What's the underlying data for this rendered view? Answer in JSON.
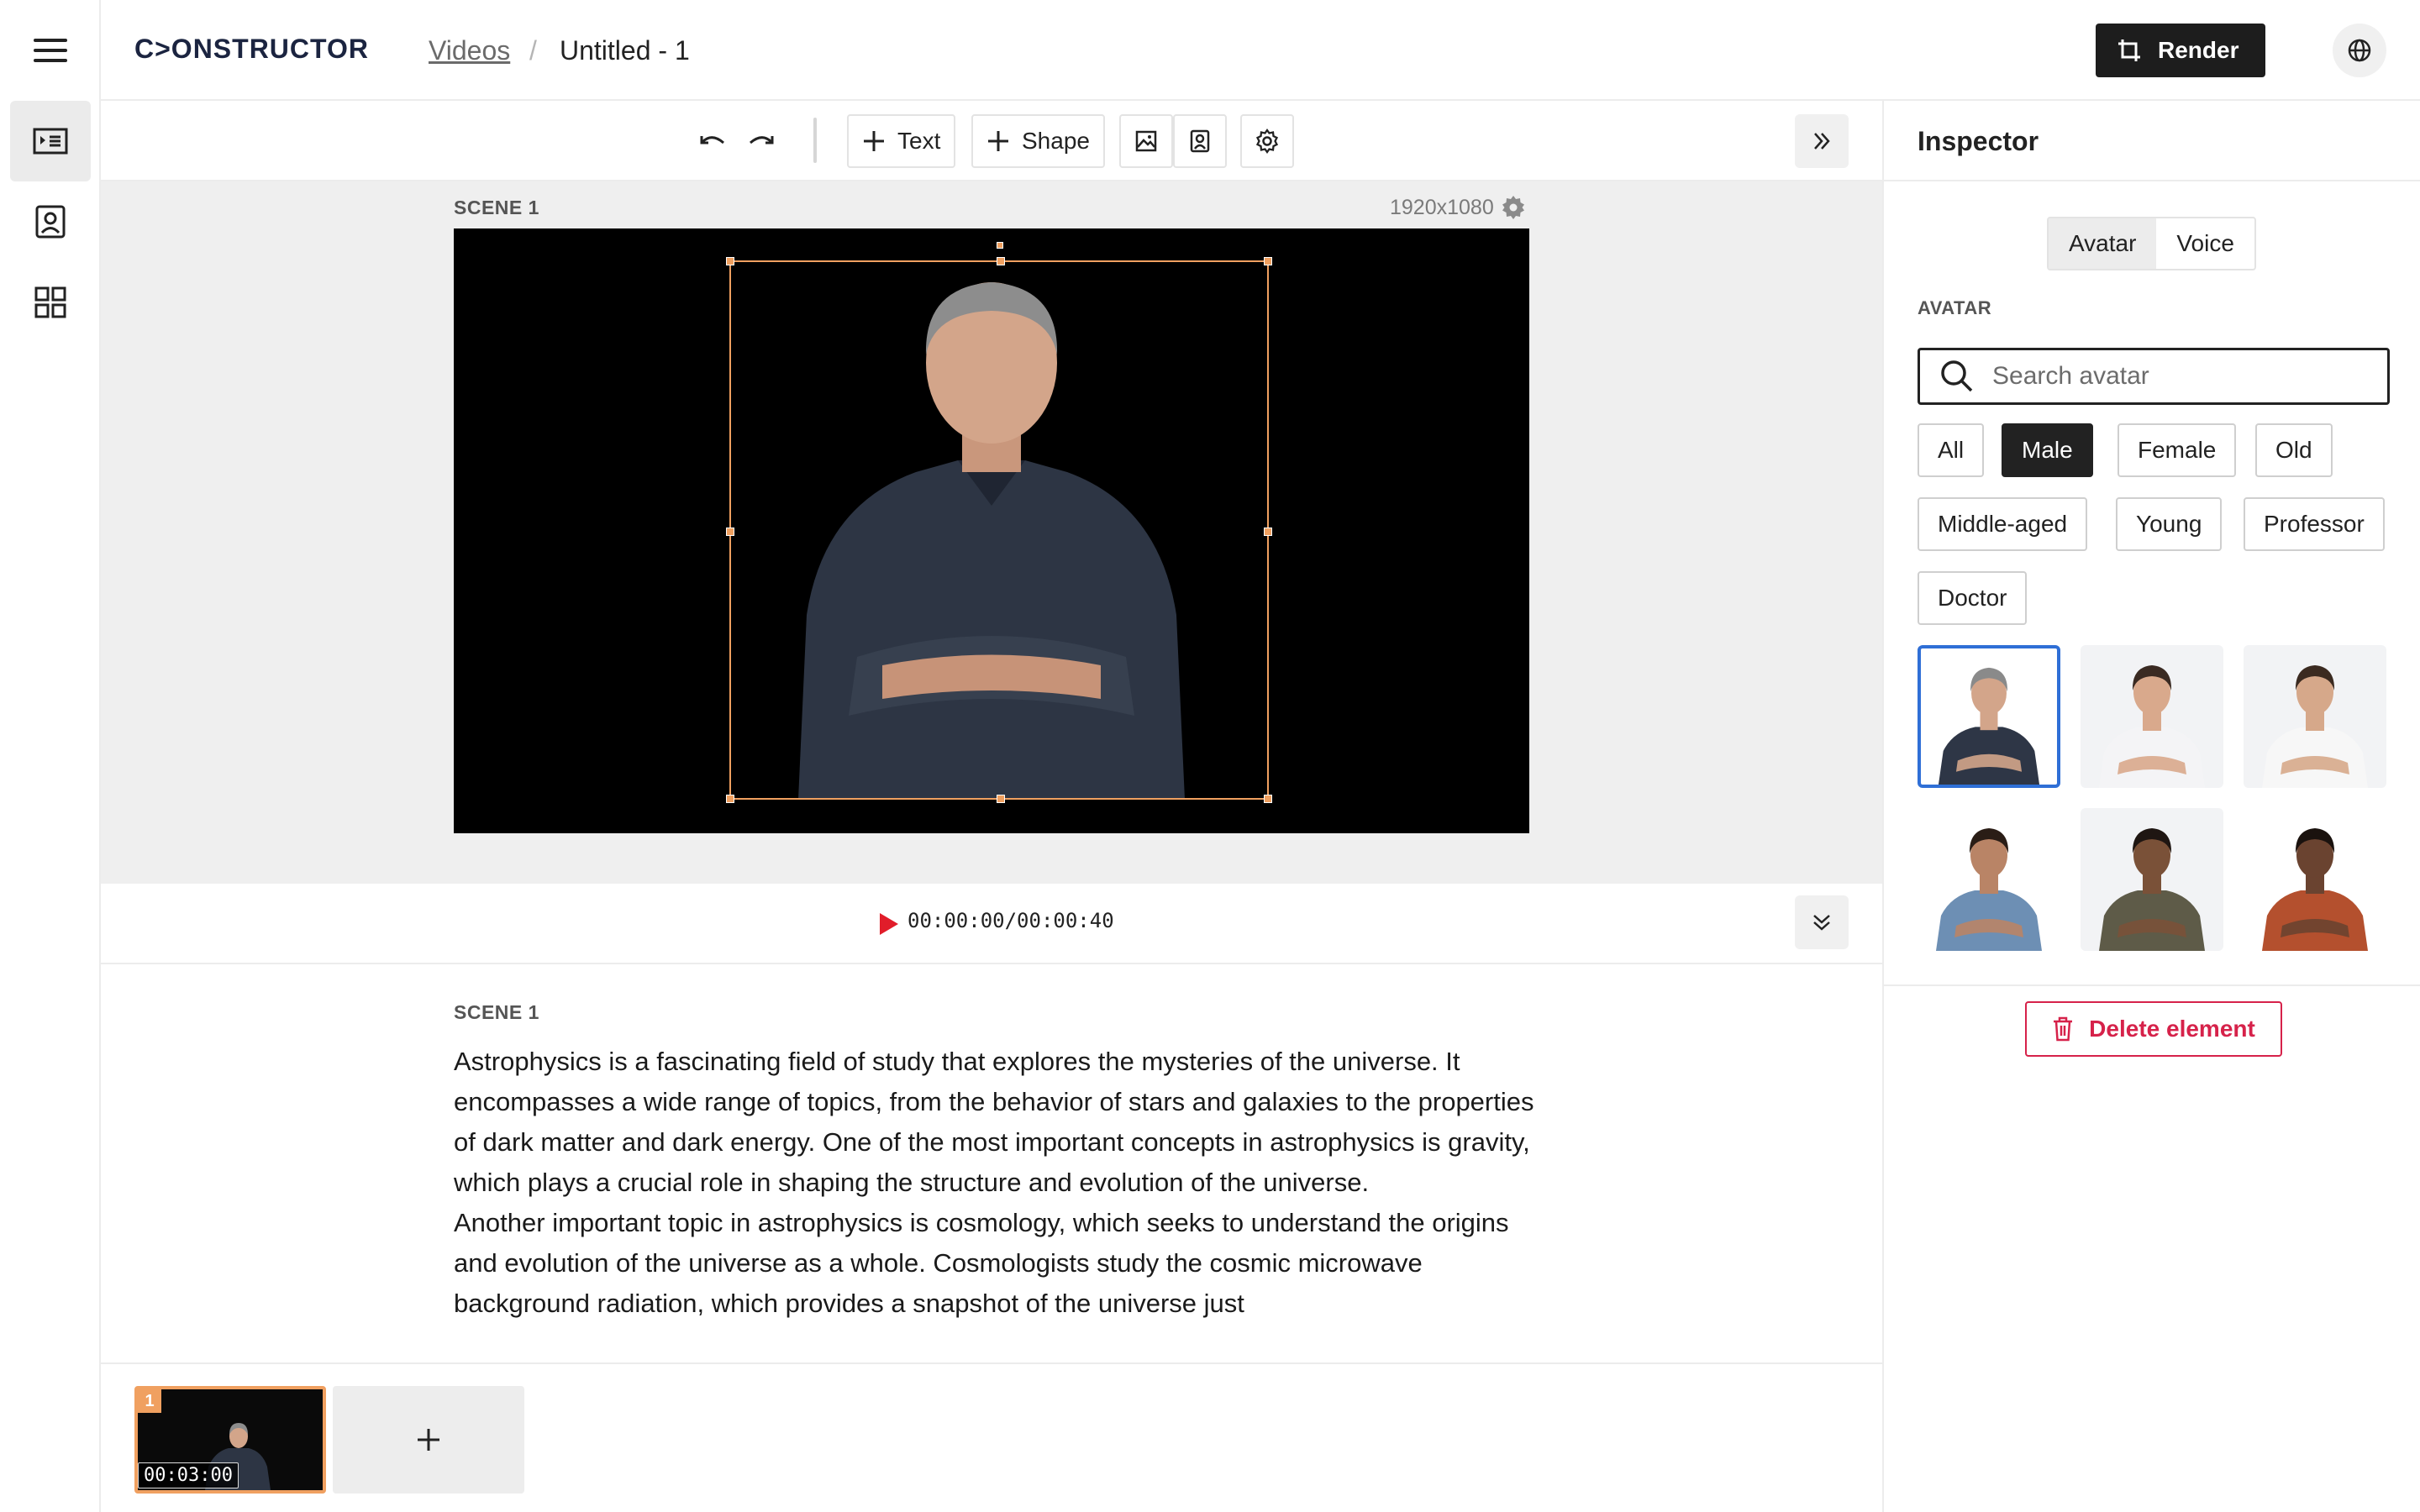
{
  "header": {
    "logo": "C>ONSTRUCTOR",
    "breadcrumb_link": "Videos",
    "breadcrumb_separator": "/",
    "title": "Untitled - 1",
    "render_label": "Render"
  },
  "rail": {
    "items": [
      {
        "icon": "script-editor-icon",
        "active": true
      },
      {
        "icon": "avatar-icon",
        "active": false
      },
      {
        "icon": "templates-grid-icon",
        "active": false
      }
    ]
  },
  "toolbar": {
    "text_label": "Text",
    "shape_label": "Shape"
  },
  "canvas": {
    "scene_label": "SCENE 1",
    "resolution": "1920x1080"
  },
  "playback": {
    "timecode": "00:00:00/00:00:40"
  },
  "script": {
    "scene_label": "SCENE 1",
    "paragraphs": [
      "Astrophysics is a fascinating field of study that explores the mysteries of the universe. It encompasses a wide range of topics, from the behavior of stars and galaxies to the properties of dark matter and dark energy. One of the most important concepts in astrophysics is gravity, which plays a crucial role in shaping the structure and evolution of the universe.",
      "Another important topic in astrophysics is cosmology, which seeks to understand the origins and evolution of the universe as a whole. Cosmologists study the cosmic microwave background radiation, which provides a snapshot of the universe just"
    ]
  },
  "timeline": {
    "scenes": [
      {
        "number": "1",
        "duration": "00:03:00"
      }
    ]
  },
  "inspector": {
    "title": "Inspector",
    "tabs": [
      {
        "label": "Avatar",
        "active": true
      },
      {
        "label": "Voice",
        "active": false
      }
    ],
    "section_label": "AVATAR",
    "search_placeholder": "Search avatar",
    "filters": [
      {
        "label": "All",
        "active": false
      },
      {
        "label": "Male",
        "active": true
      },
      {
        "label": "Female",
        "active": false
      },
      {
        "label": "Old",
        "active": false
      },
      {
        "label": "Middle-aged",
        "active": false
      },
      {
        "label": "Young",
        "active": false
      },
      {
        "label": "Professor",
        "active": false
      },
      {
        "label": "Doctor",
        "active": false
      }
    ],
    "avatars": [
      {
        "shirt": "#2e3646",
        "skin": "#d3a58a",
        "hair": "#8a8a8a",
        "bg": "#ffffff",
        "selected": true
      },
      {
        "shirt": "#f4f4f6",
        "skin": "#d9a98c",
        "hair": "#3a2a22",
        "bg": "#f2f3f5",
        "selected": false
      },
      {
        "shirt": "#f7f7f7",
        "skin": "#d6a88a",
        "hair": "#3b2a20",
        "bg": "#f2f3f5",
        "selected": false
      },
      {
        "shirt": "#6d8fb4",
        "skin": "#b98466",
        "hair": "#2a1d16",
        "bg": "#ffffff",
        "selected": false
      },
      {
        "shirt": "#5e5b48",
        "skin": "#7a5138",
        "hair": "#1f1612",
        "bg": "#f2f3f5",
        "selected": false
      },
      {
        "shirt": "#b4502e",
        "skin": "#6a4330",
        "hair": "#1a120e",
        "bg": "#ffffff",
        "selected": false
      }
    ],
    "delete_label": "Delete element"
  },
  "colors": {
    "accent_orange": "#f0a060",
    "selection_blue": "#2f6fd6",
    "danger_red": "#d6224a",
    "play_red": "#e11d2a"
  }
}
